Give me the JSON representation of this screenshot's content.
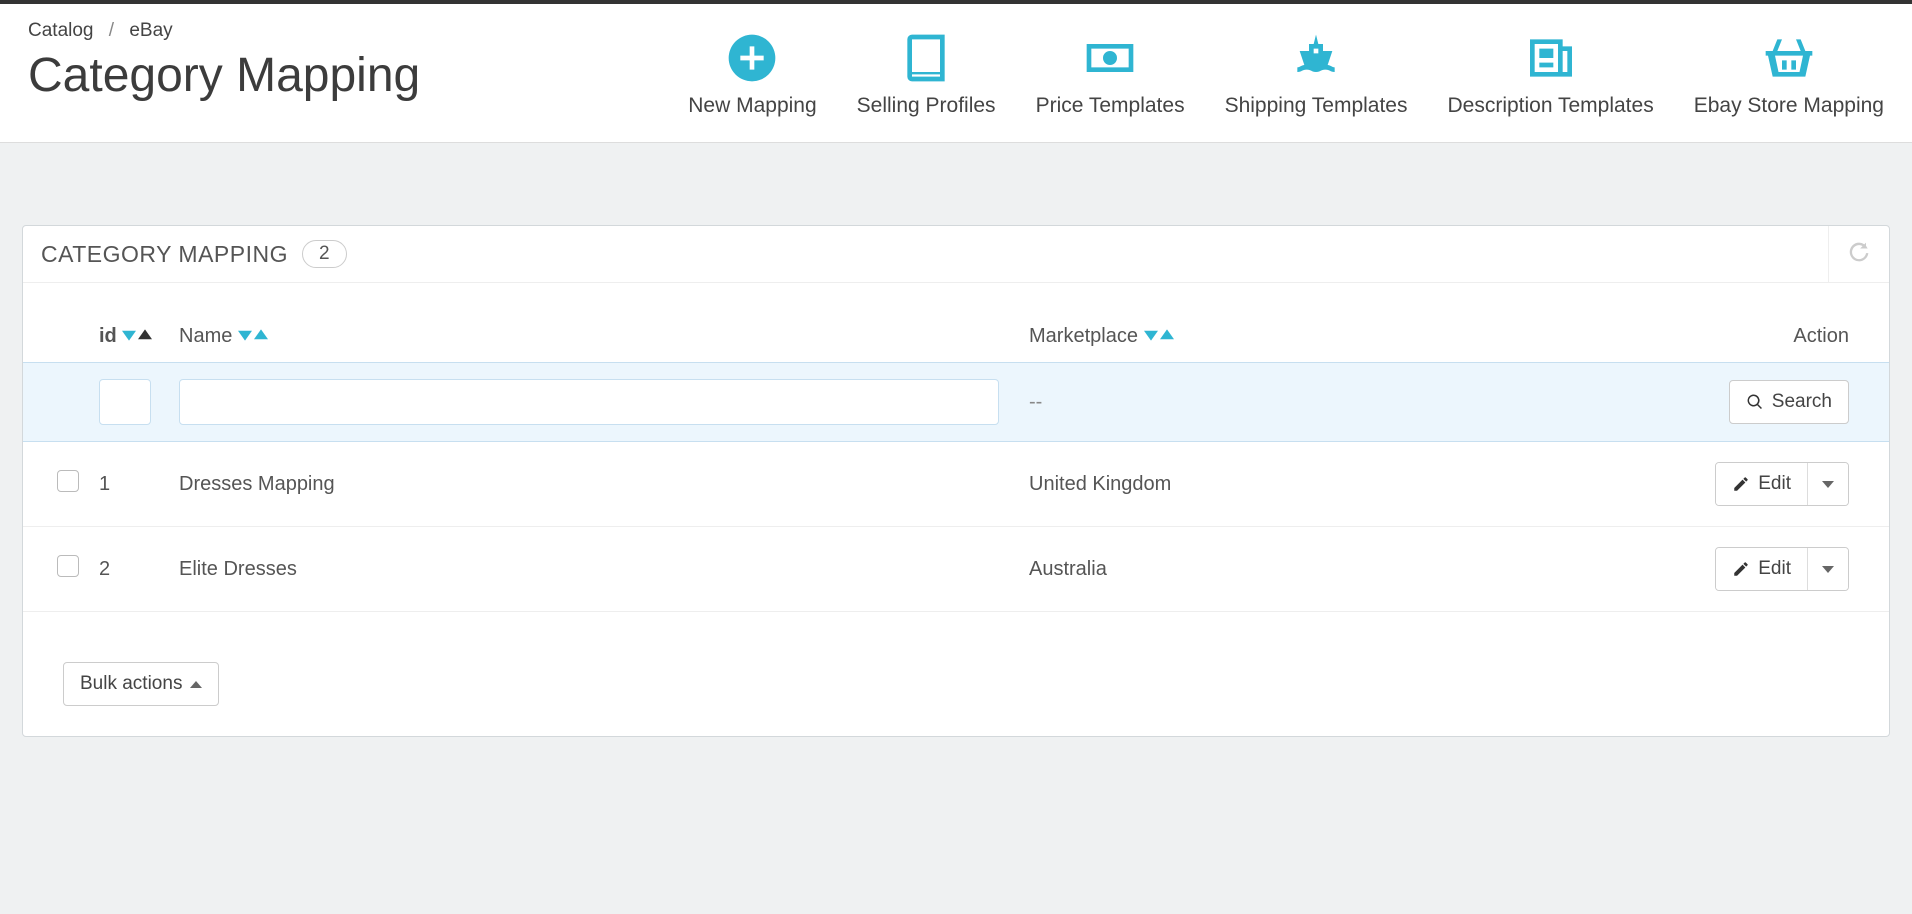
{
  "breadcrumb": {
    "item1": "Catalog",
    "item2": "eBay"
  },
  "page_title": "Category Mapping",
  "toolbar": [
    {
      "label": "New Mapping",
      "icon": "plus-circle"
    },
    {
      "label": "Selling Profiles",
      "icon": "book"
    },
    {
      "label": "Price Templates",
      "icon": "money"
    },
    {
      "label": "Shipping Templates",
      "icon": "ship"
    },
    {
      "label": "Description Templates",
      "icon": "newspaper"
    },
    {
      "label": "Ebay Store Mapping",
      "icon": "basket"
    }
  ],
  "panel": {
    "title": "CATEGORY MAPPING",
    "count": "2"
  },
  "columns": {
    "id": "id",
    "name": "Name",
    "marketplace": "Marketplace",
    "action": "Action"
  },
  "filter": {
    "marketplace_placeholder": "--",
    "search_label": "Search"
  },
  "rows": [
    {
      "id": "1",
      "name": "Dresses Mapping",
      "marketplace": "United Kingdom"
    },
    {
      "id": "2",
      "name": "Elite Dresses",
      "marketplace": "Australia"
    }
  ],
  "actions": {
    "edit": "Edit",
    "bulk": "Bulk actions"
  }
}
